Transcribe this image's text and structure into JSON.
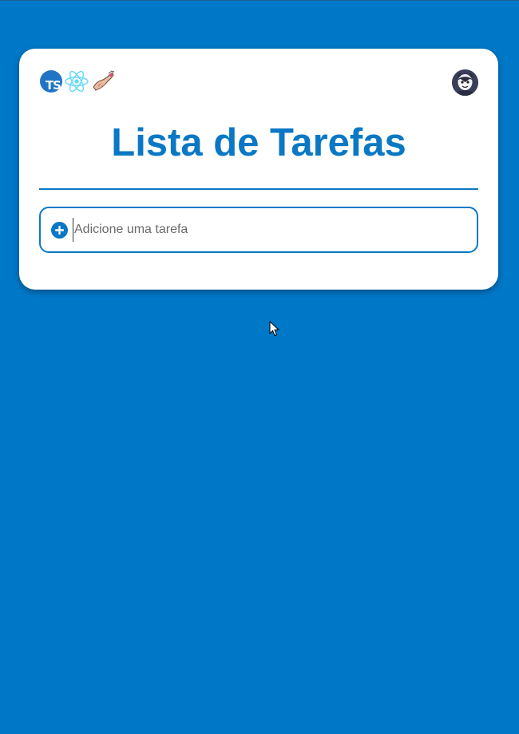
{
  "header": {
    "logos": [
      {
        "icon": "typescript-logo-icon",
        "label": "TS",
        "color": "#1f74c4"
      },
      {
        "icon": "react-logo-icon",
        "color": "#61dafb"
      },
      {
        "icon": "styled-components-logo-icon"
      }
    ],
    "avatar_icon": "user-avatar-icon"
  },
  "main": {
    "title": "Lista de Tarefas",
    "input": {
      "placeholder": "Adicione uma tarefa",
      "value": "",
      "add_icon": "plus-circle-icon"
    }
  },
  "colors": {
    "background": "#0078c8",
    "accent": "#0a78c4",
    "card": "#ffffff"
  }
}
